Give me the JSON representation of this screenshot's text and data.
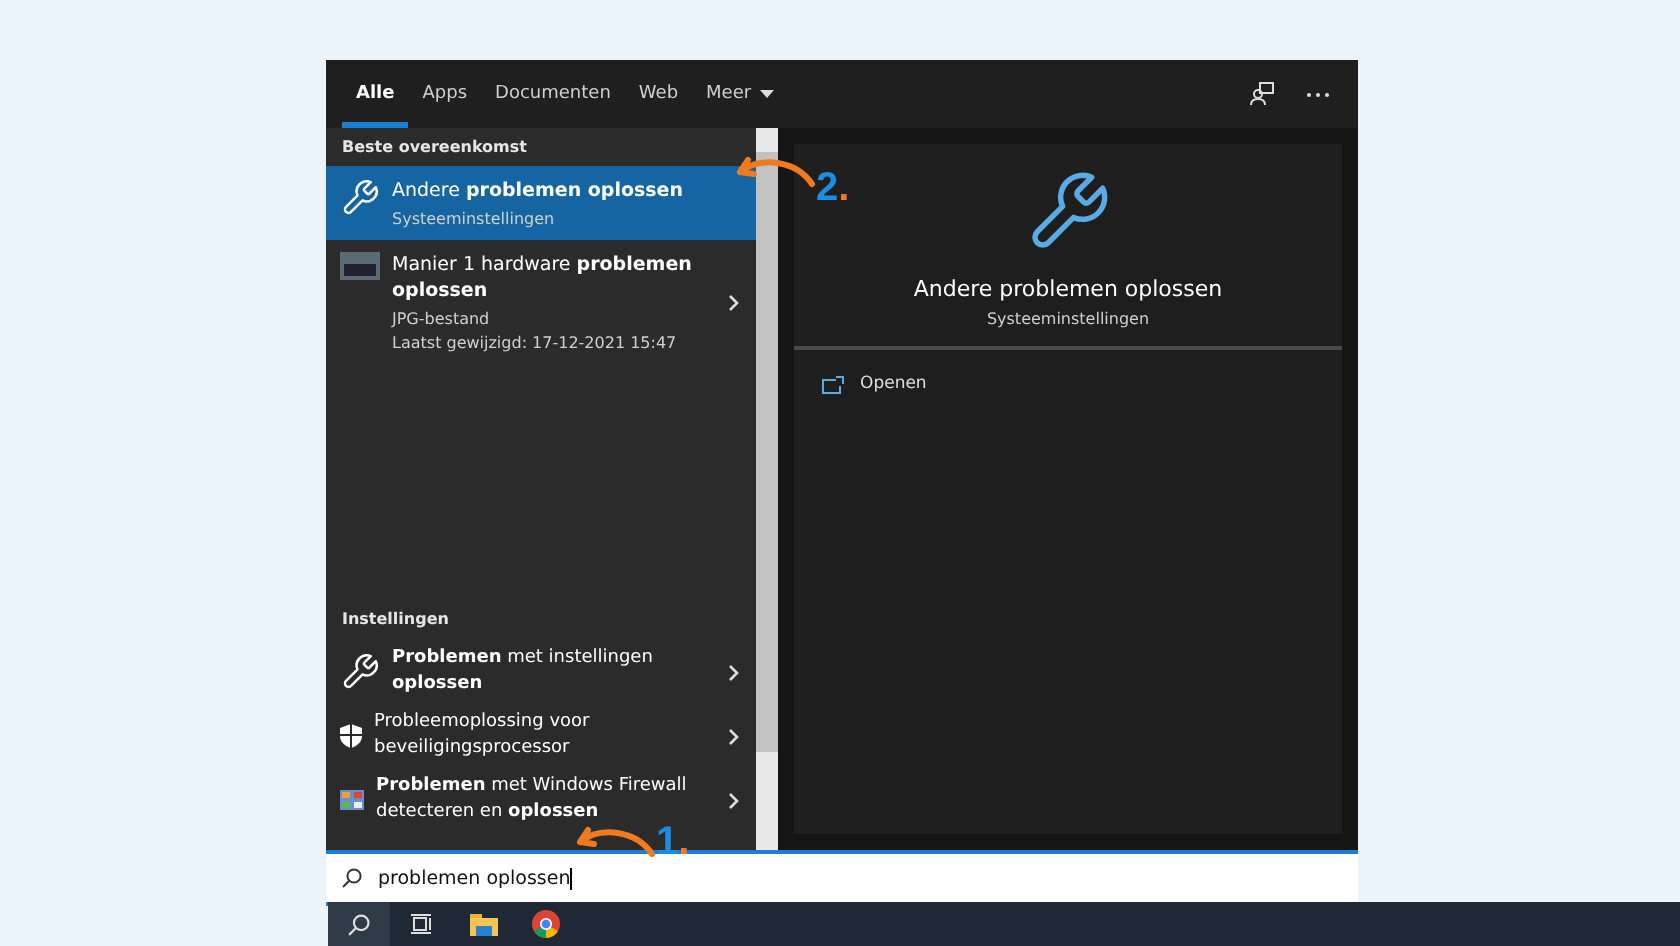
{
  "tabs": [
    {
      "label": "Alle",
      "selected": true,
      "kind": "tab"
    },
    {
      "label": "Apps",
      "selected": false,
      "kind": "tab"
    },
    {
      "label": "Documenten",
      "selected": false,
      "kind": "tab"
    },
    {
      "label": "Web",
      "selected": false,
      "kind": "tab"
    },
    {
      "label": "Meer",
      "selected": false,
      "kind": "dropdown"
    }
  ],
  "best_match": {
    "heading": "Beste overeenkomst",
    "items": [
      {
        "kind": "wrench",
        "title": "Andere **problemen oplossen**",
        "lines": [
          "Systeeminstellingen"
        ],
        "selected": true
      },
      {
        "kind": "image",
        "title": "Manier 1 hardware **problemen oplossen**",
        "lines": [
          "JPG-bestand",
          "Laatst gewijzigd: 17-12-2021 15:47"
        ],
        "selected": false
      }
    ]
  },
  "settings": {
    "heading": "Instellingen",
    "items": [
      {
        "kind": "wrench",
        "title": "**Problemen** met instellingen **oplossen**"
      },
      {
        "kind": "shield",
        "title": "Probleemoplossing voor beveiligingsprocessor"
      },
      {
        "kind": "firewall",
        "title": "**Problemen** met Windows Firewall detecteren en **oplossen**"
      }
    ]
  },
  "preview": {
    "title": "Andere problemen oplossen",
    "subtitle": "Systeeminstellingen",
    "actions": [
      {
        "label": "Openen"
      }
    ]
  },
  "search": {
    "value": "problemen oplossen"
  },
  "annotations": [
    {
      "number": "1",
      "mark": "."
    },
    {
      "number": "2",
      "mark": "."
    }
  ]
}
